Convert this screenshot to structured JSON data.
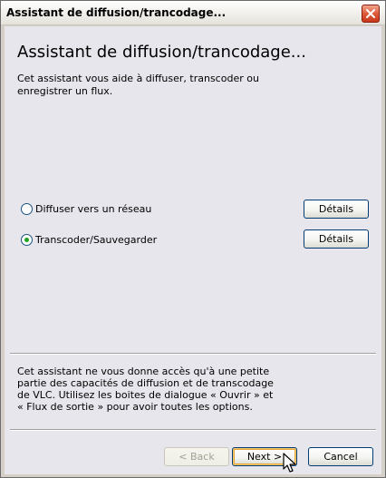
{
  "window": {
    "title": "Assistant de diffusion/trancodage..."
  },
  "page": {
    "heading": "Assistant de diffusion/trancodage...",
    "intro": "Cet assistant vous aide à diffuser, transcoder ou enregistrer un flux."
  },
  "options": [
    {
      "label": "Diffuser vers un réseau",
      "selected": false,
      "details_label": "Détails"
    },
    {
      "label": "Transcoder/Sauvegarder",
      "selected": true,
      "details_label": "Détails"
    }
  ],
  "note": "Cet assistant ne vous donne accès qu'à une petite partie des capacités de diffusion et de transcodage de VLC. Utilisez les boites de dialogue « Ouvrir » et « Flux de sortie » pour avoir toutes les options.",
  "buttons": {
    "back_label": "< Back",
    "next_label": "Next >",
    "cancel_label": "Cancel"
  },
  "icons": {
    "close": "close-icon",
    "cursor": "mouse-pointer-icon"
  },
  "colors": {
    "close_button": "#de5b3a",
    "radio_selected": "#21a121",
    "default_button_glow": "#e8a53a",
    "panel_background": "#e6e6ec"
  }
}
